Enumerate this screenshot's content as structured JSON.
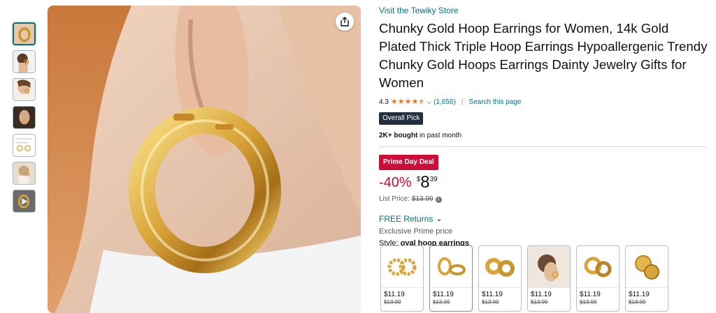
{
  "thumbnails": [
    {
      "name": "thumb-earring-closeup",
      "active": true
    },
    {
      "name": "thumb-model-side"
    },
    {
      "name": "thumb-model-wearing"
    },
    {
      "name": "thumb-ear-detail"
    },
    {
      "name": "thumb-size-chart"
    },
    {
      "name": "thumb-model-portrait"
    },
    {
      "name": "thumb-video"
    }
  ],
  "product": {
    "store_link": "Visit the Tewiky Store",
    "title": "Chunky Gold Hoop Earrings for Women, 14k Gold Plated Thick Triple Hoop Earrings Hypoallergenic Trendy Chunky Gold Hoops Earrings Dainty Jewelry Gifts for Women",
    "rating": "4.3",
    "rating_value": 4.3,
    "rating_count": "(1,656)",
    "search_page": "Search this page",
    "overall_pick": "Overall Pick",
    "bought_bold": "2K+ bought",
    "bought_rest": " in past month",
    "deal_badge": "Prime Day Deal",
    "discount": "-40%",
    "price_symbol": "$",
    "price_whole": "8",
    "price_fraction": "39",
    "list_price_label": "List Price:",
    "list_price": "$13.99",
    "free_returns": "FREE Returns",
    "prime_price": "Exclusive Prime price",
    "style_label": "Style:",
    "style_value": "oval hoop earrings"
  },
  "swatches": [
    {
      "price": "$11.19",
      "list": "$13.99",
      "kind": "twisted-hoops",
      "selected": false
    },
    {
      "price": "$11.19",
      "list": "$13.99",
      "kind": "oval-hoops",
      "selected": true
    },
    {
      "price": "$11.19",
      "list": "$13.99",
      "kind": "chunky-hoops",
      "selected": false
    },
    {
      "price": "$11.19",
      "list": "$13.99",
      "kind": "model-photo",
      "selected": false
    },
    {
      "price": "$11.19",
      "list": "$13.99",
      "kind": "thick-hoops",
      "selected": false
    },
    {
      "price": "$11.19",
      "list": "$13.99",
      "kind": "dome-hoops",
      "selected": false
    }
  ],
  "colors": {
    "link": "#007185",
    "deal_red": "#cc0c39",
    "star": "#de7921",
    "badge_dark": "#232f3e",
    "gold": "#d9a53a"
  }
}
